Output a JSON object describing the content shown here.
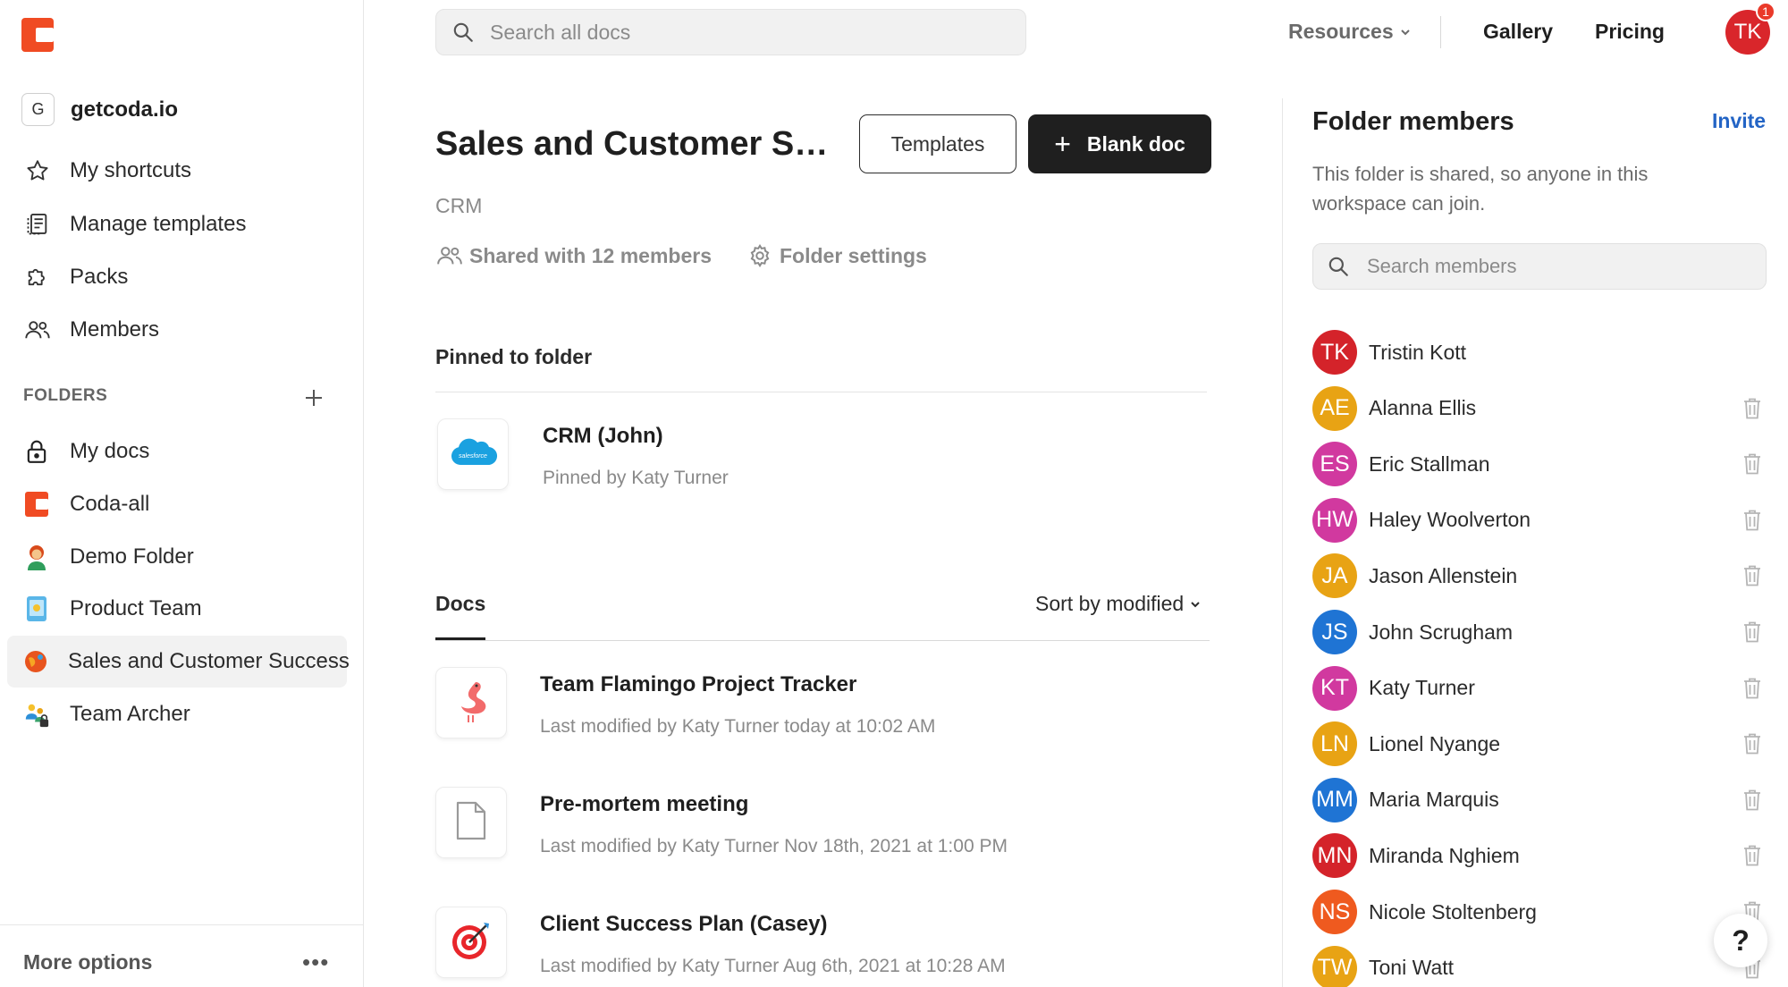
{
  "workspace": {
    "badge": "G",
    "name": "getcoda.io"
  },
  "sidebar": {
    "nav": [
      {
        "label": "My shortcuts",
        "icon": "star-icon"
      },
      {
        "label": "Manage templates",
        "icon": "templates-icon"
      },
      {
        "label": "Packs",
        "icon": "puzzle-icon"
      },
      {
        "label": "Members",
        "icon": "people-icon"
      }
    ],
    "folders_header": "FOLDERS",
    "folders": [
      {
        "label": "My docs",
        "icon": "lock-icon",
        "active": false
      },
      {
        "label": "Coda-all",
        "icon": "coda-icon",
        "active": false
      },
      {
        "label": "Demo Folder",
        "icon": "person-emoji-icon",
        "active": false
      },
      {
        "label": "Product Team",
        "icon": "phone-emoji-icon",
        "active": false
      },
      {
        "label": "Sales and Customer Success",
        "icon": "globe-emoji-icon",
        "active": true
      },
      {
        "label": "Team Archer",
        "icon": "team-emoji-icon",
        "active": false
      }
    ],
    "more_options": "More options"
  },
  "topbar": {
    "search_placeholder": "Search all docs",
    "resources": "Resources",
    "gallery": "Gallery",
    "pricing": "Pricing",
    "avatar_initials": "TK",
    "notification_count": "1"
  },
  "folder": {
    "title": "Sales and Customer Success",
    "subtitle": "CRM",
    "shared": "Shared with 12 members",
    "settings": "Folder settings",
    "templates_btn": "Templates",
    "blank_doc_btn": "Blank doc"
  },
  "pinned": {
    "heading": "Pinned to folder",
    "item": {
      "title": "CRM (John)",
      "subtitle": "Pinned by Katy Turner",
      "icon": "salesforce-icon"
    }
  },
  "docs": {
    "tab": "Docs",
    "sort": "Sort by modified",
    "items": [
      {
        "title": "Team Flamingo Project Tracker",
        "subtitle": "Last modified by Katy Turner today at 10:02 AM",
        "icon": "flamingo-icon"
      },
      {
        "title": "Pre-mortem meeting",
        "subtitle": "Last modified by Katy Turner Nov 18th, 2021 at 1:00 PM",
        "icon": "document-icon"
      },
      {
        "title": "Client Success Plan (Casey)",
        "subtitle": "Last modified by Katy Turner Aug 6th, 2021 at 10:28 AM",
        "icon": "target-icon"
      }
    ]
  },
  "members_panel": {
    "title": "Folder members",
    "invite": "Invite",
    "description": "This folder is shared, so anyone in this workspace can join.",
    "search_placeholder": "Search members",
    "members": [
      {
        "initials": "TK",
        "name": "Tristin Kott",
        "color": "#d4232a",
        "deletable": false
      },
      {
        "initials": "AE",
        "name": "Alanna Ellis",
        "color": "#e8a314",
        "deletable": true
      },
      {
        "initials": "ES",
        "name": "Eric Stallman",
        "color": "#d1399f",
        "deletable": true
      },
      {
        "initials": "HW",
        "name": "Haley Woolverton",
        "color": "#d1399f",
        "deletable": true
      },
      {
        "initials": "JA",
        "name": "Jason Allenstein",
        "color": "#e8a314",
        "deletable": true
      },
      {
        "initials": "JS",
        "name": "John Scrugham",
        "color": "#1f74d4",
        "deletable": true
      },
      {
        "initials": "KT",
        "name": "Katy Turner",
        "color": "#d1399f",
        "deletable": true
      },
      {
        "initials": "LN",
        "name": "Lionel Nyange",
        "color": "#e8a314",
        "deletable": true
      },
      {
        "initials": "MM",
        "name": "Maria Marquis",
        "color": "#1f74d4",
        "deletable": true
      },
      {
        "initials": "MN",
        "name": "Miranda Nghiem",
        "color": "#d4232a",
        "deletable": true
      },
      {
        "initials": "NS",
        "name": "Nicole Stoltenberg",
        "color": "#ef5a1f",
        "deletable": true
      },
      {
        "initials": "TW",
        "name": "Toni Watt",
        "color": "#e8a314",
        "deletable": true
      }
    ]
  },
  "help_label": "?"
}
